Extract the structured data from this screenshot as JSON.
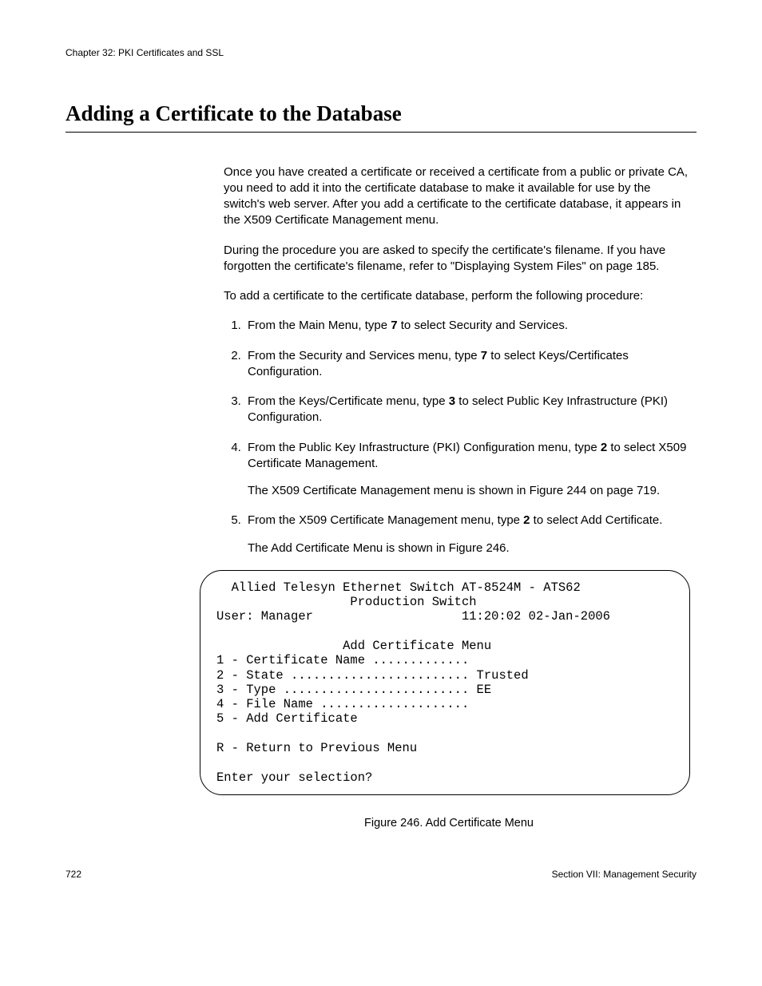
{
  "header": {
    "chapter": "Chapter 32: PKI Certificates and SSL"
  },
  "title": "Adding a Certificate to the Database",
  "paragraphs": {
    "p1": "Once you have created a certificate or received a certificate from a public or private CA, you need to add it into the certificate database to make it available for use by the switch's web server. After you add a certificate to the certificate database, it appears in the X509 Certificate Management menu.",
    "p2": "During the procedure you are asked to specify the certificate's filename. If you have forgotten the certificate's filename, refer to \"Displaying System Files\" on page 185.",
    "p3": "To add a certificate to the certificate database, perform the following procedure:"
  },
  "steps": {
    "s1a": "From the Main Menu, type ",
    "s1b": "7",
    "s1c": " to select Security and Services.",
    "s2a": "From the Security and Services menu, type ",
    "s2b": "7",
    "s2c": " to select Keys/Certificates Configuration.",
    "s3a": "From the Keys/Certificate menu, type ",
    "s3b": "3",
    "s3c": " to select Public Key Infrastructure (PKI) Configuration.",
    "s4a": "From the Public Key Infrastructure (PKI) Configuration menu, type ",
    "s4b": "2",
    "s4c": " to select X509 Certificate Management.",
    "s4note": "The X509 Certificate Management menu is shown in Figure 244 on page 719.",
    "s5a": "From the X509 Certificate Management menu, type ",
    "s5b": "2",
    "s5c": " to select Add Certificate.",
    "s5note": "The Add Certificate Menu is shown in Figure 246."
  },
  "terminal": {
    "line1": "  Allied Telesyn Ethernet Switch AT-8524M - ATS62",
    "line2": "                  Production Switch",
    "line3": "User: Manager                    11:20:02 02-Jan-2006",
    "blank1": "",
    "line4": "                 Add Certificate Menu",
    "line5": "1 - Certificate Name .............",
    "line6": "2 - State ........................ Trusted",
    "line7": "3 - Type ......................... EE",
    "line8": "4 - File Name ....................",
    "line9": "5 - Add Certificate",
    "blank2": "",
    "line10": "R - Return to Previous Menu",
    "blank3": "",
    "line11": "Enter your selection?"
  },
  "figure_caption": "Figure 246. Add Certificate Menu",
  "footer": {
    "page": "722",
    "section": "Section VII: Management Security"
  }
}
